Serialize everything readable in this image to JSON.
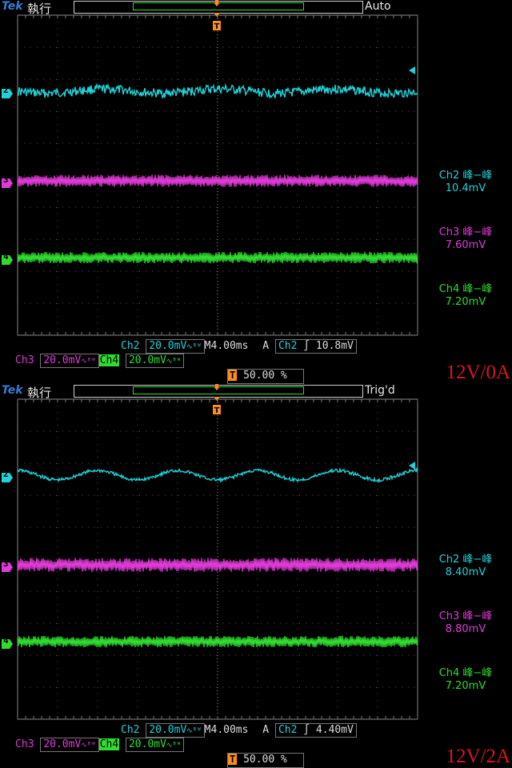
{
  "panels": [
    {
      "brand": "Tek",
      "state": "執行",
      "mode": "Auto",
      "trigger_marker": "T",
      "channel_markers": [
        "2",
        "3",
        "4"
      ],
      "measurements": [
        {
          "label": "Ch2 峰−峰",
          "value": "10.4mV",
          "color": "#1fd2d8"
        },
        {
          "label": "Ch3 峰−峰",
          "value": "7.60mV",
          "color": "#e03ad8"
        },
        {
          "label": "Ch4 峰−峰",
          "value": "7.20mV",
          "color": "#2fdc2f"
        }
      ],
      "status_row1": {
        "ch": "Ch2",
        "scale": "20.0mV",
        "coupling": "∿ᴮᵂ",
        "timebase": "M4.00ms",
        "trig_src_prefix": "A",
        "trig_ch": "Ch2",
        "slope": "∫",
        "trig_level": "10.8mV"
      },
      "status_row2": {
        "ch3": "Ch3",
        "ch3_scale": "20.0mV",
        "ch3_coupling": "∿ᴮᵂ",
        "ch4": "Ch4",
        "ch4_scale": "20.0mV",
        "ch4_coupling": "∿ᴮᵂ"
      },
      "position": {
        "badge": "T",
        "value": "50.00 %"
      },
      "load_label": "12V/0A",
      "traces": [
        {
          "channel": "2",
          "color": "#1fd2d8",
          "shape": "noisy-flat",
          "p2p_mv": 10.4
        },
        {
          "channel": "3",
          "color": "#e03ad8",
          "shape": "noise-band",
          "p2p_mv": 7.6
        },
        {
          "channel": "4",
          "color": "#2fdc2f",
          "shape": "noise-band",
          "p2p_mv": 7.2
        }
      ]
    },
    {
      "brand": "Tek",
      "state": "執行",
      "mode": "Trig'd",
      "trigger_marker": "T",
      "channel_markers": [
        "2",
        "3",
        "4"
      ],
      "measurements": [
        {
          "label": "Ch2 峰−峰",
          "value": "8.40mV",
          "color": "#1fd2d8"
        },
        {
          "label": "Ch3 峰−峰",
          "value": "8.80mV",
          "color": "#e03ad8"
        },
        {
          "label": "Ch4 峰−峰",
          "value": "7.20mV",
          "color": "#2fdc2f"
        }
      ],
      "status_row1": {
        "ch": "Ch2",
        "scale": "20.0mV",
        "coupling": "∿ᴮᵂ",
        "timebase": "M4.00ms",
        "trig_src_prefix": "A",
        "trig_ch": "Ch2",
        "slope": "∫",
        "trig_level": "4.40mV"
      },
      "status_row2": {
        "ch3": "Ch3",
        "ch3_scale": "20.0mV",
        "ch3_coupling": "∿ᴮᵂ",
        "ch4": "Ch4",
        "ch4_scale": "20.0mV",
        "ch4_coupling": "∿ᴮᵂ"
      },
      "position": {
        "badge": "T",
        "value": "50.00 %"
      },
      "load_label": "12V/2A",
      "traces": [
        {
          "channel": "2",
          "color": "#1fd2d8",
          "shape": "sine",
          "p2p_mv": 8.4
        },
        {
          "channel": "3",
          "color": "#e03ad8",
          "shape": "noise-band",
          "p2p_mv": 8.8
        },
        {
          "channel": "4",
          "color": "#2fdc2f",
          "shape": "noise-band",
          "p2p_mv": 7.2
        }
      ]
    }
  ]
}
